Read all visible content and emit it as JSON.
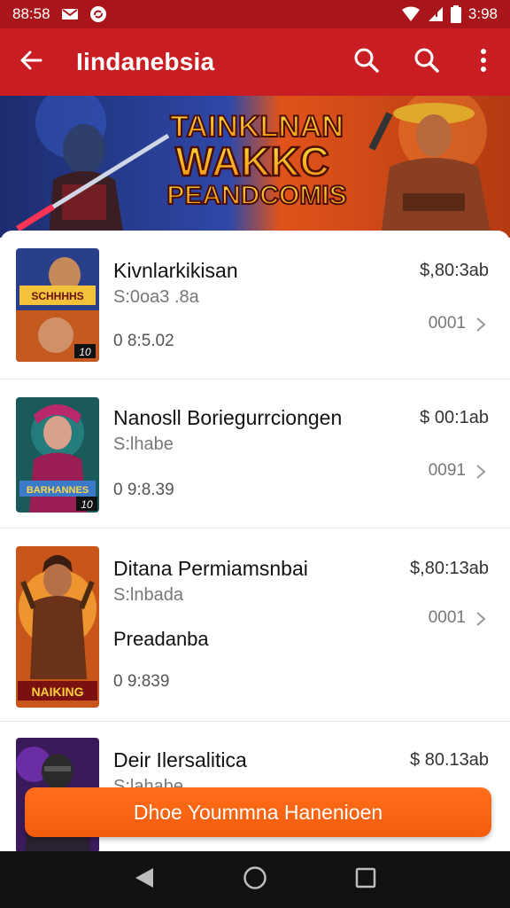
{
  "status_bar": {
    "time_left": "88:58",
    "time_right": "3:98",
    "icons": [
      "mail-notification-icon",
      "sync-notification-icon",
      "wifi-icon",
      "signal-icon",
      "battery-icon"
    ]
  },
  "app_bar": {
    "title": "Iindanebsia",
    "icons": [
      "back-arrow-icon",
      "search-icon",
      "search-icon",
      "more-vert-icon"
    ]
  },
  "banner": {
    "line1": "TAINKLNAN",
    "line2": "WAKKC",
    "line3": "PEANDCOMIS"
  },
  "items": [
    {
      "title": "Kivnlarkikisan",
      "subtitle": "S:0oa3 .8a",
      "extra": "",
      "date": "0 8:5.02",
      "price": "$,80:3ab",
      "count": "0001",
      "thumb_label": "SCHHHHS",
      "thumb_badge": "10"
    },
    {
      "title": "Nanosll Boriegurrciongen",
      "subtitle": "S:lhabe",
      "extra": "",
      "date": "0 9:8.39",
      "price": "$ 00:1ab",
      "count": "0091",
      "thumb_label": "BARHANNES",
      "thumb_badge": "10"
    },
    {
      "title": "Ditana Permiamsnbai",
      "subtitle": "S:lnbada",
      "extra": "Preadanba",
      "date": "0 9:839",
      "price": "$,80:13ab",
      "count": "0001",
      "thumb_label": "NAIKING",
      "thumb_badge": ""
    },
    {
      "title": "Deir Ilersalitica",
      "subtitle": "S:lahabe",
      "extra": "",
      "date": "",
      "price": "$ 80.13ab",
      "count": "",
      "thumb_label": "",
      "thumb_badge": ""
    }
  ],
  "action_button": {
    "label": "Dhoe Yoummna Hanenioen"
  },
  "nav_bar": {
    "icons": [
      "back-triangle-icon",
      "home-circle-icon",
      "recents-square-icon"
    ]
  },
  "colors": {
    "app_bar": "#c81e23",
    "status_bar": "#a8161c",
    "action_button": "#f56410",
    "nav_bar": "#111111"
  }
}
